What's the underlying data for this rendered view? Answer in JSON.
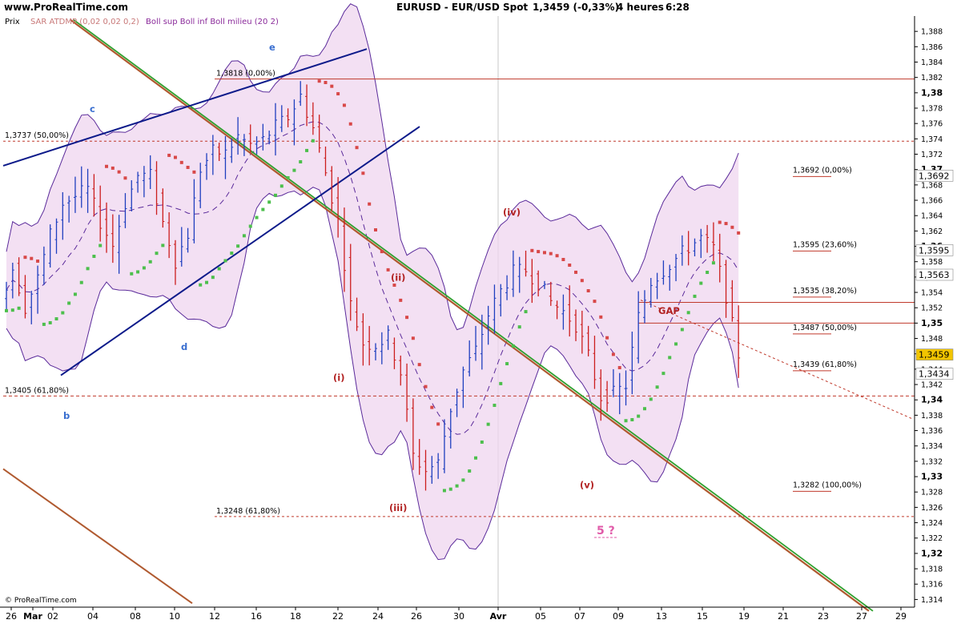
{
  "header": {
    "site": "www.ProRealTime.com",
    "title": "EURUSD - EUR/USD Spot",
    "last": "1,3459 (-0,33%)",
    "timeframe": "4 heures",
    "time": "6:28"
  },
  "legend": {
    "prix": "Prix",
    "sar": "SAR ATDMP (0,02 0,02 0,2)",
    "boll": "Boll sup Boll inf Boll milieu (20 2)"
  },
  "watermark": "© ProRealTime.com",
  "colors": {
    "background": "#ffffff",
    "bull_bar": "#1f3fbf",
    "bear_bar": "#cc1e1e",
    "sar_up": "#4cbf4c",
    "sar_down": "#d84848",
    "band_fill": "#efd6ef",
    "band_line": "#5a2a9a",
    "trend_green": "#2ea02e",
    "trend_brown": "#b05a30",
    "channel": "#0c1a8a",
    "fib_red": "#c0392b",
    "label_red": "#b22222",
    "label_blue": "#3a6fd0",
    "label_pink": "#e05aa8"
  },
  "chart_data": {
    "type": "candlestick",
    "ylim": [
      1.313,
      1.39
    ],
    "y_ticks": [
      "1,388",
      "1,386",
      "1,384",
      "1,382",
      "1,38",
      "1,378",
      "1,376",
      "1,374",
      "1,372",
      "1,37",
      "1,368",
      "1,366",
      "1,364",
      "1,362",
      "1,36",
      "1,358",
      "1,356",
      "1,354",
      "1,352",
      "1,35",
      "1,348",
      "1,346",
      "1,344",
      "1,342",
      "1,34",
      "1,338",
      "1,336",
      "1,334",
      "1,332",
      "1,33",
      "1,328",
      "1,326",
      "1,324",
      "1,322",
      "1,32",
      "1,318",
      "1,316",
      "1,314"
    ],
    "x_ticks": [
      "26",
      "Mar",
      "02",
      "04",
      "08",
      "10",
      "12",
      "16",
      "18",
      "22",
      "24",
      "26",
      "30",
      "Avr",
      "05",
      "07",
      "09",
      "13",
      "15",
      "19",
      "21",
      "23",
      "27",
      "29"
    ],
    "right_labels": [
      {
        "text": "1,3692",
        "value": 1.3692
      },
      {
        "text": "1,3595",
        "value": 1.3595
      },
      {
        "text": "1,3563",
        "value": 1.3563
      },
      {
        "text": "1,3459",
        "value": 1.3459,
        "highlight": true
      },
      {
        "text": "1,3434",
        "value": 1.3434
      }
    ],
    "fib_labels": [
      {
        "text": "1,3818 (0,00%)",
        "value": 1.3818
      },
      {
        "text": "1,3737 (50,00%)",
        "value": 1.3737
      },
      {
        "text": "1,3405 (61,80%)",
        "value": 1.3405
      },
      {
        "text": "1,3248 (61,80%)",
        "value": 1.3248
      },
      {
        "text": "1,3692 (0,00%)",
        "value": 1.3692
      },
      {
        "text": "1,3595 (23,60%)",
        "value": 1.3595
      },
      {
        "text": "1,3535 (38,20%)",
        "value": 1.3535
      },
      {
        "text": "1,3487 (50,00%)",
        "value": 1.3487
      },
      {
        "text": "1,3439 (61,80%)",
        "value": 1.3439
      },
      {
        "text": "1,3282 (100,00%)",
        "value": 1.3282
      }
    ],
    "wave_labels": [
      {
        "text": "e",
        "value": 1.3855
      },
      {
        "text": "c",
        "value": 1.3775
      },
      {
        "text": "d",
        "value": 1.3465
      },
      {
        "text": "b",
        "value": 1.3375
      },
      {
        "text": "(i)",
        "value": 1.3425
      },
      {
        "text": "(ii)",
        "value": 1.3555
      },
      {
        "text": "(iii)",
        "value": 1.3255
      },
      {
        "text": "(iv)",
        "value": 1.364
      },
      {
        "text": "(v)",
        "value": 1.3285
      },
      {
        "text": "5 ?",
        "value": 1.3225
      },
      {
        "text": "GAP",
        "value": 1.3512
      }
    ],
    "levels": [
      1.3818,
      1.3737,
      1.3405,
      1.3248,
      1.3527,
      1.35
    ],
    "series": [
      {
        "name": "EURUSD",
        "close": [
          1.3532,
          1.3572,
          1.3521,
          1.3558,
          1.3615,
          1.3656,
          1.3665,
          1.3674,
          1.3632,
          1.3601,
          1.3656,
          1.3692,
          1.3692,
          1.3631,
          1.3581,
          1.3616,
          1.3701,
          1.3723,
          1.3721,
          1.3743,
          1.3732,
          1.3738,
          1.3756,
          1.3768,
          1.3796,
          1.3754,
          1.3696,
          1.3633,
          1.3524,
          1.3474,
          1.3472,
          1.3482,
          1.3436,
          1.3327,
          1.3308,
          1.3318,
          1.3389,
          1.3438,
          1.3464,
          1.3511,
          1.3542,
          1.3566,
          1.3569,
          1.3553,
          1.3528,
          1.3515,
          1.3498,
          1.3457,
          1.3404,
          1.3408,
          1.3419,
          1.3508,
          1.3554,
          1.3569,
          1.3584,
          1.3599,
          1.3611,
          1.3597,
          1.3536,
          1.3459
        ]
      }
    ]
  }
}
